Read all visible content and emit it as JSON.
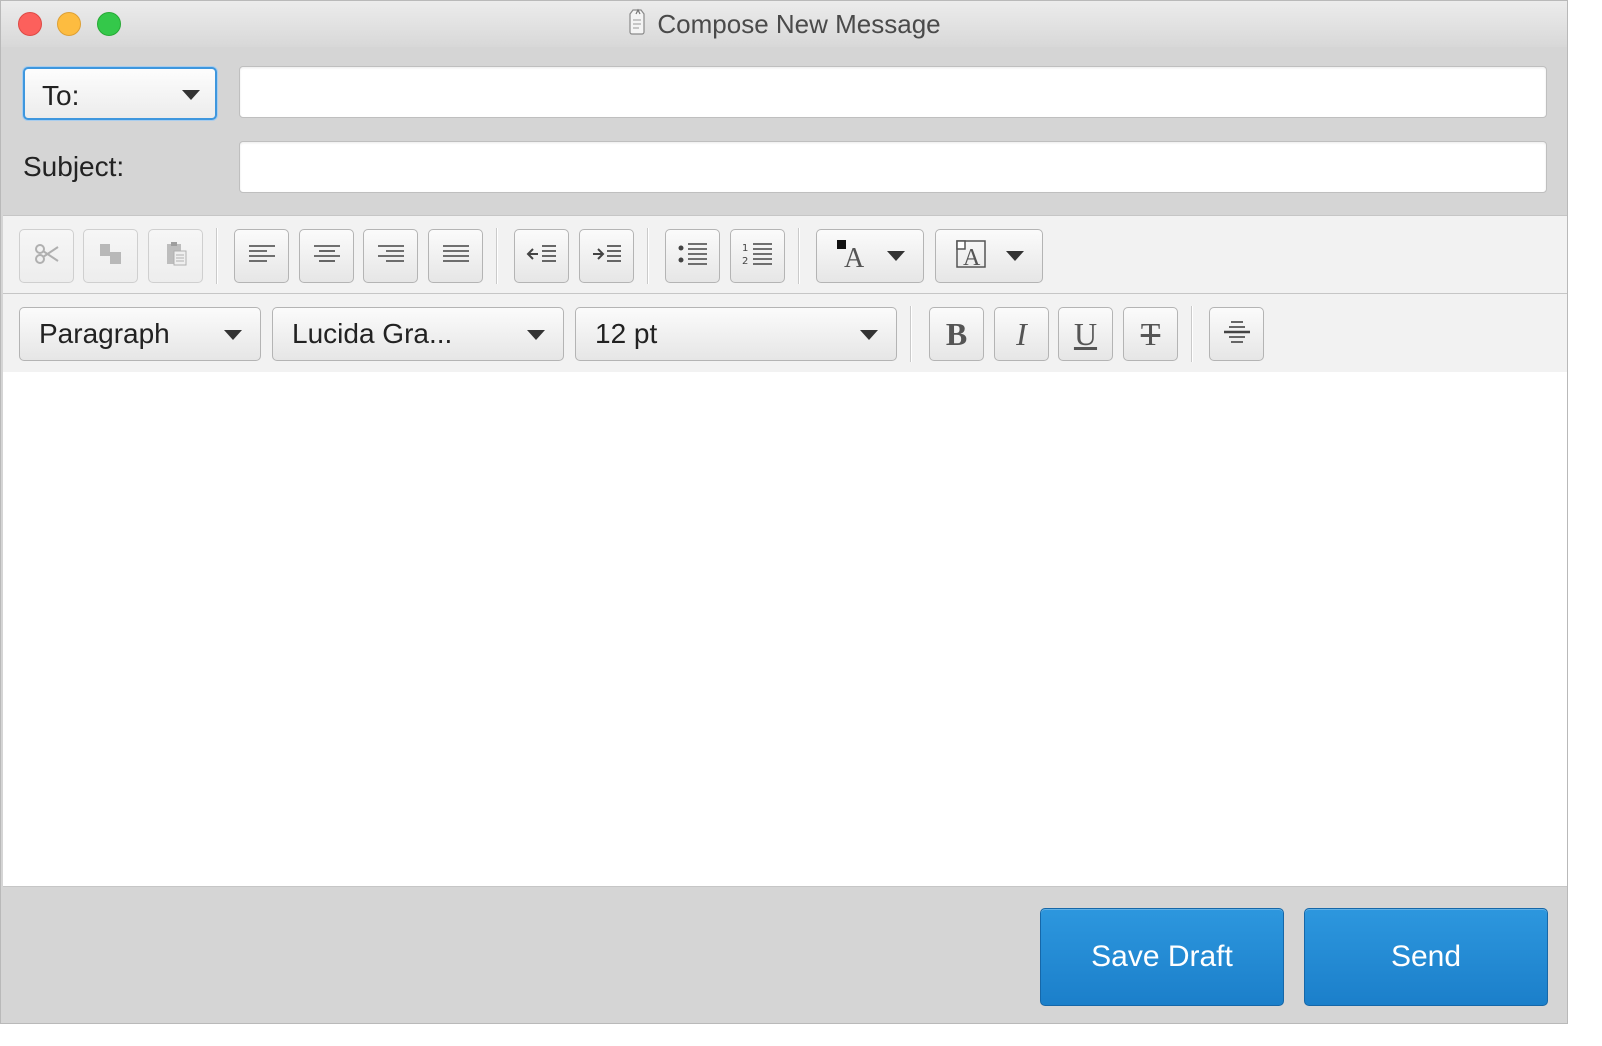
{
  "window": {
    "title": "Compose New Message"
  },
  "header": {
    "to_label": "To:",
    "to_value": "",
    "subject_label": "Subject:",
    "subject_value": ""
  },
  "formatting": {
    "block_format": "Paragraph",
    "font_family": "Lucida Gra...",
    "font_size": "12 pt"
  },
  "toolbar_icons": [
    "cut-icon",
    "copy-icon",
    "paste-icon",
    "align-left-icon",
    "align-center-icon",
    "align-right-icon",
    "align-justify-icon",
    "outdent-icon",
    "indent-icon",
    "bullet-list-icon",
    "numbered-list-icon",
    "text-color-icon",
    "background-color-icon",
    "bold-icon",
    "italic-icon",
    "underline-icon",
    "strikethrough-icon",
    "horizontal-rule-icon"
  ],
  "actions": {
    "save_draft": "Save Draft",
    "send": "Send"
  },
  "colors": {
    "accent": "#1f8ad3",
    "focus_ring": "#3e97de",
    "close": "#fc605c",
    "minimize": "#fdbc40",
    "maximize": "#34c84a"
  }
}
